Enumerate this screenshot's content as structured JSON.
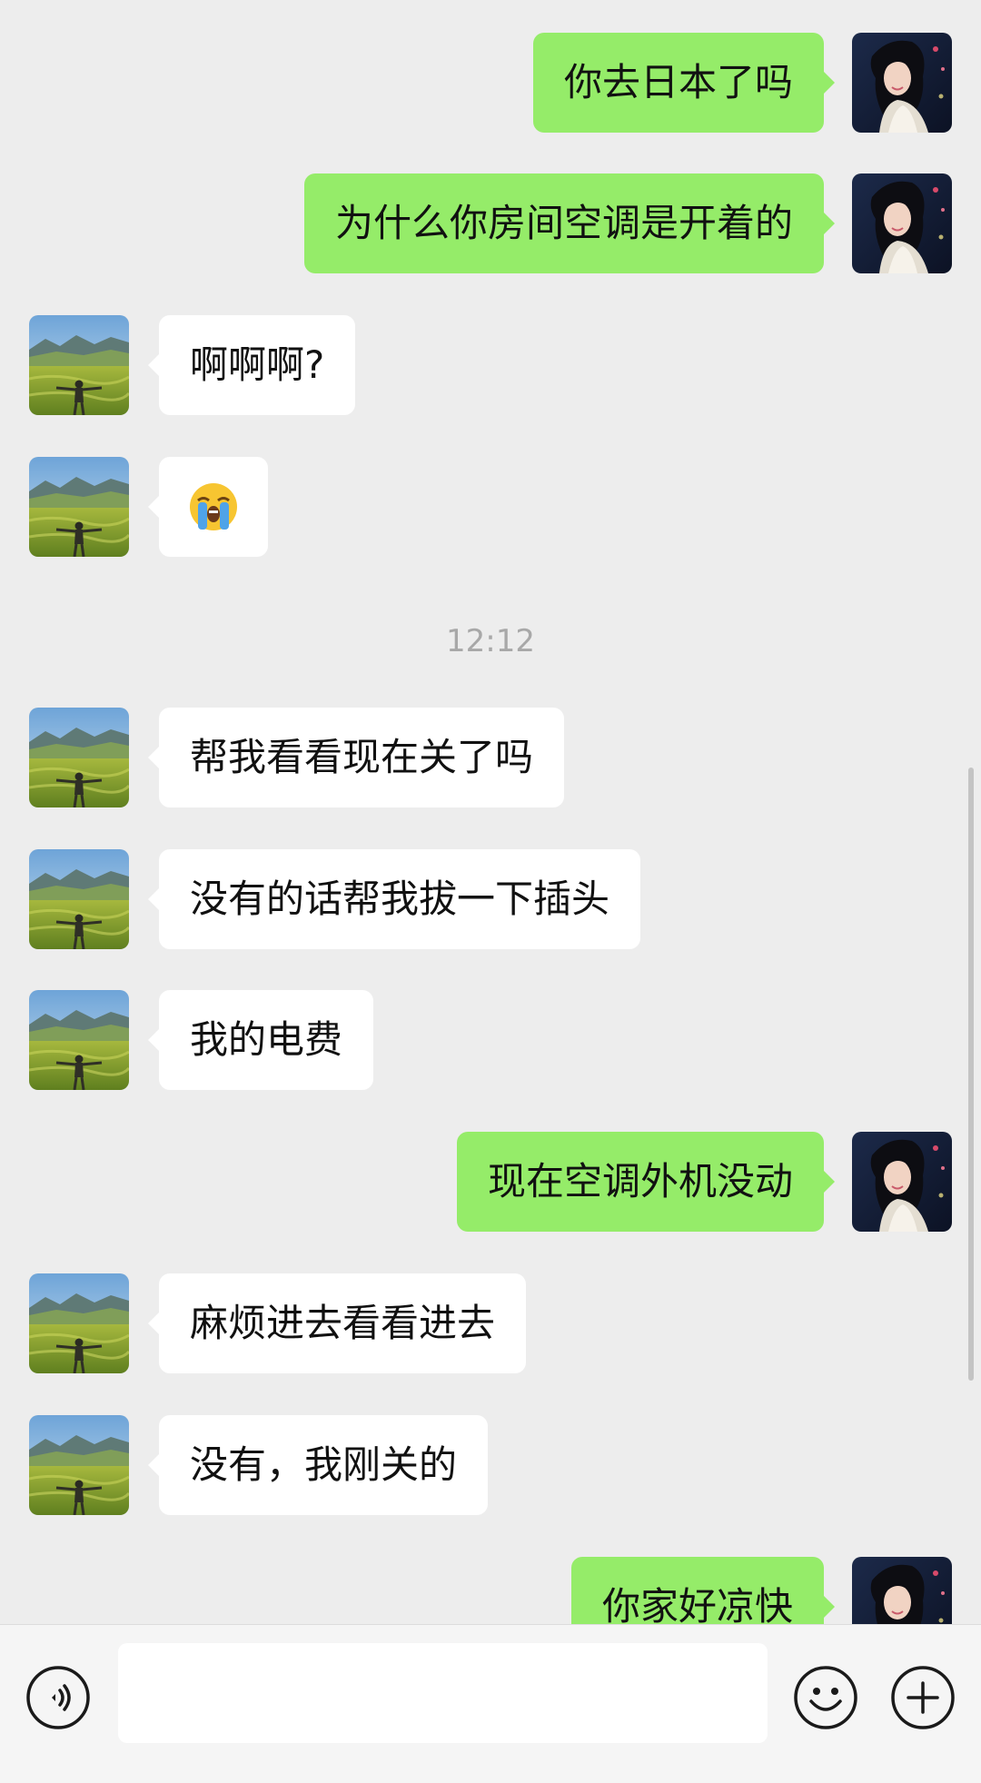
{
  "chat": {
    "messages": [
      {
        "side": "out",
        "text": "你去日本了吗"
      },
      {
        "side": "out",
        "text": "为什么你房间空调是开着的"
      },
      {
        "side": "in",
        "text": "啊啊啊?"
      },
      {
        "side": "in",
        "emoji": "loudly-crying-face-emoji"
      },
      {
        "side": "in",
        "text": "帮我看看现在关了吗"
      },
      {
        "side": "in",
        "text": "没有的话帮我拔一下插头"
      },
      {
        "side": "in",
        "text": "我的电费"
      },
      {
        "side": "out",
        "text": "现在空调外机没动"
      },
      {
        "side": "in",
        "text": "麻烦进去看看进去"
      },
      {
        "side": "in",
        "text": "没有，我刚关的"
      },
      {
        "side": "out",
        "text": "你家好凉快"
      }
    ],
    "timestamp": "12:12"
  },
  "input_bar": {
    "value": "",
    "voice_icon": "voice-icon",
    "emoji_icon": "emoji-icon",
    "plus_icon": "plus-icon"
  },
  "colors": {
    "background": "#ededed",
    "outgoing_bubble": "#95ec69",
    "incoming_bubble": "#ffffff",
    "timestamp_text": "#a8a8a8"
  }
}
